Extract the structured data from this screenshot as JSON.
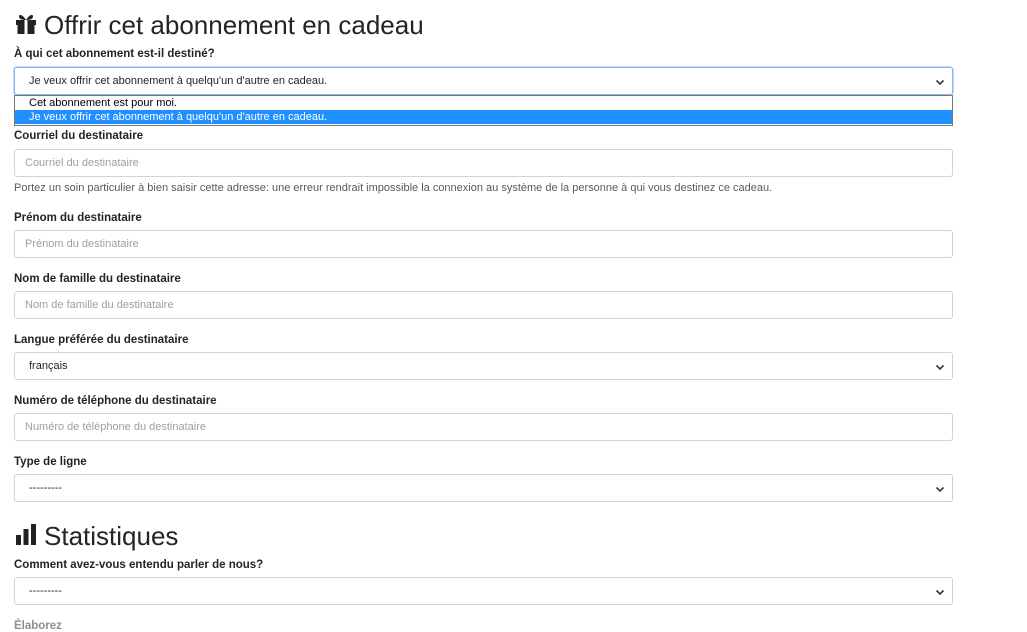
{
  "gift_section": {
    "title": "Offrir cet abonnement en cadeau",
    "icon": "gift-icon",
    "recipient_question": "À qui cet abonnement est-il destiné?",
    "recipient_select": {
      "value": "Je veux offrir cet abonnement à quelqu'un d'autre en cadeau.",
      "options": [
        "Cet abonnement est pour moi.",
        "Je veux offrir cet abonnement à quelqu'un d'autre en cadeau."
      ],
      "selected_index": 1
    },
    "email": {
      "label": "Courriel du destinataire",
      "placeholder": "Courriel du destinataire",
      "help": "Portez un soin particulier à bien saisir cette adresse: une erreur rendrait impossible la connexion au système de la personne à qui vous destinez ce cadeau."
    },
    "first_name": {
      "label": "Prénom du destinataire",
      "placeholder": "Prénom du destinataire"
    },
    "last_name": {
      "label": "Nom de famille du destinataire",
      "placeholder": "Nom de famille du destinataire"
    },
    "language": {
      "label": "Langue préférée du destinataire",
      "value": "français"
    },
    "phone": {
      "label": "Numéro de téléphone du destinataire",
      "placeholder": "Numéro de téléphone du destinataire"
    },
    "line_type": {
      "label": "Type de ligne",
      "value": "---------"
    }
  },
  "stats_section": {
    "title": "Statistiques",
    "icon": "bar-chart-icon",
    "source": {
      "label": "Comment avez-vous entendu parler de nous?",
      "value": "---------"
    },
    "elaborate_label": "Élaborez"
  },
  "colors": {
    "focus_border": "#86b7fe",
    "option_highlight": "#1e90ff"
  }
}
